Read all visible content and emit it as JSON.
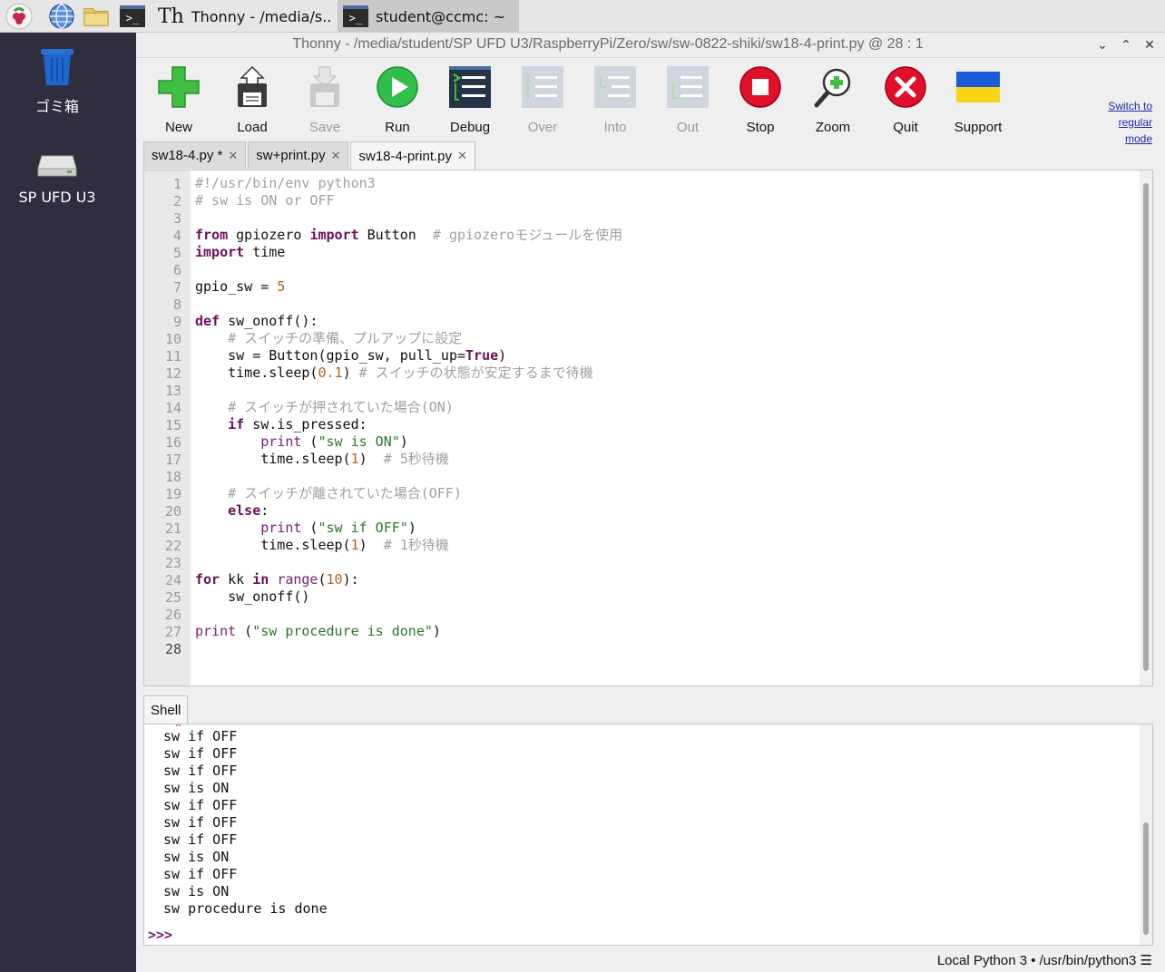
{
  "taskbar": {
    "tasks": [
      {
        "label": "Thonny  -  /media/s.."
      },
      {
        "label": "student@ccmc: ~"
      }
    ],
    "terminal_glyph": ">_"
  },
  "desktop": {
    "items": [
      {
        "label": "ゴミ箱",
        "icon": "trash-icon"
      },
      {
        "label": "SP UFD U3",
        "icon": "drive-icon"
      }
    ]
  },
  "window": {
    "title": "Thonny  -  /media/student/SP UFD U3/RaspberryPi/Zero/sw/sw-0822-shiki/sw18-4-print.py  @  28 : 1",
    "controls": {
      "minimize": "⌄",
      "maximize": "⌃",
      "close": "✕"
    }
  },
  "toolbar": {
    "buttons": [
      {
        "label": "New",
        "enabled": true
      },
      {
        "label": "Load",
        "enabled": true
      },
      {
        "label": "Save",
        "enabled": false
      },
      {
        "label": "Run",
        "enabled": true
      },
      {
        "label": "Debug",
        "enabled": true
      },
      {
        "label": "Over",
        "enabled": false
      },
      {
        "label": "Into",
        "enabled": false
      },
      {
        "label": "Out",
        "enabled": false
      },
      {
        "label": "Stop",
        "enabled": true
      },
      {
        "label": "Zoom",
        "enabled": true
      },
      {
        "label": "Quit",
        "enabled": true
      },
      {
        "label": "Support",
        "enabled": true
      }
    ],
    "mode_link": [
      "Switch to",
      "regular",
      "mode"
    ]
  },
  "tabs": [
    {
      "label": "sw18-4.py *",
      "close": "✕"
    },
    {
      "label": "sw+print.py",
      "close": "✕"
    },
    {
      "label": "sw18-4-print.py",
      "close": "✕"
    }
  ],
  "editor": {
    "current_line": 28,
    "lines": [
      "#!/usr/bin/env python3",
      "# sw is ON or OFF",
      "",
      "from gpiozero import Button  # gpiozeroモジュールを使用",
      "import time",
      "",
      "gpio_sw = 5",
      "",
      "def sw_onoff():",
      "    # スイッチの準備、プルアップに設定",
      "    sw = Button(gpio_sw, pull_up=True)",
      "    time.sleep(0.1) # スイッチの状態が安定するまで待機",
      "",
      "    # スイッチが押されていた場合(ON)",
      "    if sw.is_pressed:",
      "        print (\"sw is ON\")",
      "        time.sleep(1)  # 5秒待機",
      "",
      "    # スイッチが離されていた場合(OFF)",
      "    else:",
      "        print (\"sw if OFF\")",
      "        time.sleep(1)  # 1秒待機",
      "",
      "for kk in range(10):",
      "    sw_onoff()",
      "",
      "print (\"sw procedure is done\")",
      ""
    ]
  },
  "shell": {
    "tab_label": "Shell",
    "output": [
      "sw if OFF",
      "sw if OFF",
      "sw if OFF",
      "sw is ON",
      "sw if OFF",
      "sw if OFF",
      "sw if OFF",
      "sw is ON",
      "sw if OFF",
      "sw is ON",
      "sw procedure is done"
    ],
    "prompt": ">>>"
  },
  "status": "Local Python 3  •  /usr/bin/python3  ☰"
}
